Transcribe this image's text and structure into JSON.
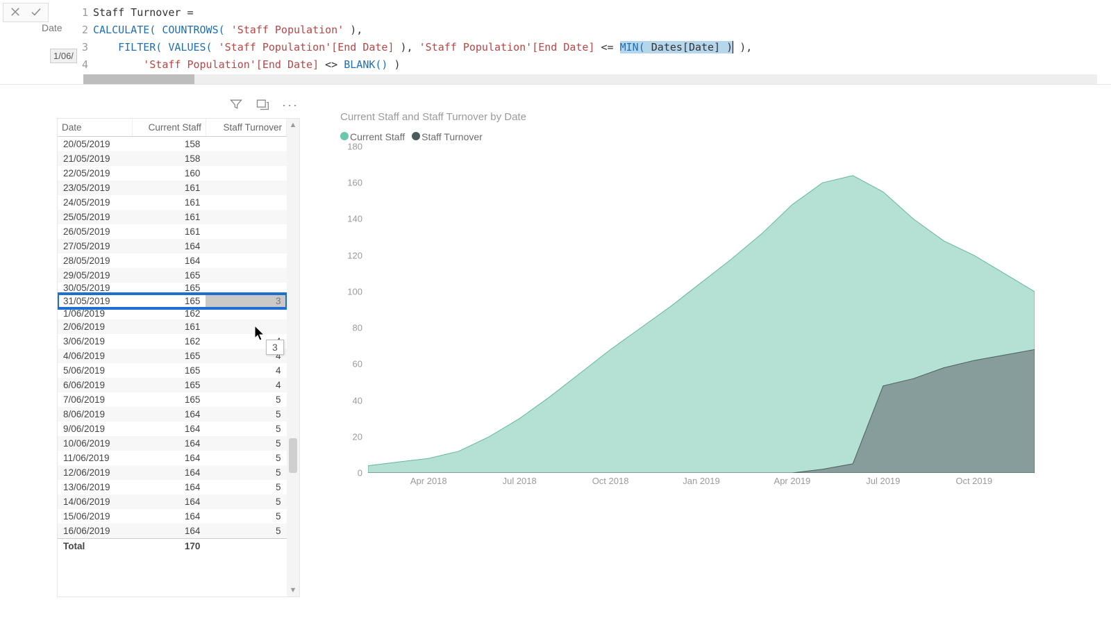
{
  "formula": {
    "date_label": "Date",
    "date_value": "1/06/",
    "lines": [
      "1",
      "2",
      "3",
      "4"
    ],
    "code": {
      "l1_name": "Staff Turnover =",
      "l2_pre": "CALCULATE( ",
      "l2_countrows": "COUNTROWS( ",
      "l2_tbl": "'Staff Population'",
      "l2_end": " ),",
      "l3_filter": "    FILTER( ",
      "l3_values": "VALUES( ",
      "l3_col1": "'Staff Population'[End Date]",
      "l3_mid": " ), ",
      "l3_col2": "'Staff Population'[End Date]",
      "l3_op": " <= ",
      "l3_min": "MIN( ",
      "l3_datescol": "Dates[Date]",
      "l3_minclose": " )",
      "l3_end": " ),",
      "l4_pre": "        ",
      "l4_col": "'Staff Population'[End Date]",
      "l4_op": " <> ",
      "l4_blank": "BLANK()",
      "l4_end": " )"
    }
  },
  "tooltip_value": "3",
  "table": {
    "headers": [
      "Date",
      "Current Staff",
      "Staff Turnover"
    ],
    "rows": [
      {
        "d": "20/05/2019",
        "cs": "158",
        "st": ""
      },
      {
        "d": "21/05/2019",
        "cs": "158",
        "st": ""
      },
      {
        "d": "22/05/2019",
        "cs": "160",
        "st": ""
      },
      {
        "d": "23/05/2019",
        "cs": "161",
        "st": ""
      },
      {
        "d": "24/05/2019",
        "cs": "161",
        "st": ""
      },
      {
        "d": "25/05/2019",
        "cs": "161",
        "st": ""
      },
      {
        "d": "26/05/2019",
        "cs": "161",
        "st": ""
      },
      {
        "d": "27/05/2019",
        "cs": "164",
        "st": ""
      },
      {
        "d": "28/05/2019",
        "cs": "164",
        "st": ""
      },
      {
        "d": "29/05/2019",
        "cs": "165",
        "st": ""
      },
      {
        "d": "30/05/2019",
        "cs": "165",
        "st": "",
        "clipped": true
      },
      {
        "d": "31/05/2019",
        "cs": "165",
        "st": "3",
        "selected": true
      },
      {
        "d": "1/06/2019",
        "cs": "162",
        "st": "",
        "clipped": true
      },
      {
        "d": "2/06/2019",
        "cs": "161",
        "st": ""
      },
      {
        "d": "3/06/2019",
        "cs": "162",
        "st": "4"
      },
      {
        "d": "4/06/2019",
        "cs": "165",
        "st": "4"
      },
      {
        "d": "5/06/2019",
        "cs": "165",
        "st": "4"
      },
      {
        "d": "6/06/2019",
        "cs": "165",
        "st": "4"
      },
      {
        "d": "7/06/2019",
        "cs": "165",
        "st": "5"
      },
      {
        "d": "8/06/2019",
        "cs": "164",
        "st": "5"
      },
      {
        "d": "9/06/2019",
        "cs": "164",
        "st": "5"
      },
      {
        "d": "10/06/2019",
        "cs": "164",
        "st": "5"
      },
      {
        "d": "11/06/2019",
        "cs": "164",
        "st": "5"
      },
      {
        "d": "12/06/2019",
        "cs": "164",
        "st": "5"
      },
      {
        "d": "13/06/2019",
        "cs": "164",
        "st": "5"
      },
      {
        "d": "14/06/2019",
        "cs": "164",
        "st": "5"
      },
      {
        "d": "15/06/2019",
        "cs": "164",
        "st": "5"
      },
      {
        "d": "16/06/2019",
        "cs": "164",
        "st": "5"
      }
    ],
    "total_label": "Total",
    "total_value": "170"
  },
  "chart": {
    "title": "Current Staff and Staff Turnover by Date",
    "legend": [
      {
        "label": "Current Staff",
        "color": "#8fd0bd"
      },
      {
        "label": "Staff Turnover",
        "color": "#5b6b6b"
      }
    ],
    "y_ticks": [
      180,
      160,
      140,
      120,
      100,
      80,
      60,
      40,
      20,
      0
    ],
    "x_ticks": [
      "Apr 2018",
      "Jul 2018",
      "Oct 2018",
      "Jan 2019",
      "Apr 2019",
      "Jul 2019",
      "Oct 2019"
    ]
  },
  "chart_data": {
    "type": "area",
    "title": "Current Staff and Staff Turnover by Date",
    "xlabel": "",
    "ylabel": "",
    "ylim": [
      0,
      180
    ],
    "x": [
      "Feb 2018",
      "Mar 2018",
      "Apr 2018",
      "May 2018",
      "Jun 2018",
      "Jul 2018",
      "Aug 2018",
      "Sep 2018",
      "Oct 2018",
      "Nov 2018",
      "Dec 2018",
      "Jan 2019",
      "Feb 2019",
      "Mar 2019",
      "Apr 2019",
      "May 2019",
      "Jun 2019",
      "Jul 2019",
      "Aug 2019",
      "Sep 2019",
      "Oct 2019",
      "Nov 2019",
      "Dec 2019"
    ],
    "series": [
      {
        "name": "Current Staff",
        "color": "#8fd0bd",
        "values": [
          4,
          6,
          8,
          12,
          20,
          30,
          42,
          55,
          68,
          80,
          92,
          105,
          118,
          132,
          148,
          160,
          164,
          155,
          140,
          128,
          120,
          110,
          100
        ]
      },
      {
        "name": "Staff Turnover",
        "color": "#5b6b6b",
        "values": [
          0,
          0,
          0,
          0,
          0,
          0,
          0,
          0,
          0,
          0,
          0,
          0,
          0,
          0,
          0,
          2,
          5,
          48,
          52,
          58,
          62,
          65,
          68
        ]
      }
    ]
  }
}
